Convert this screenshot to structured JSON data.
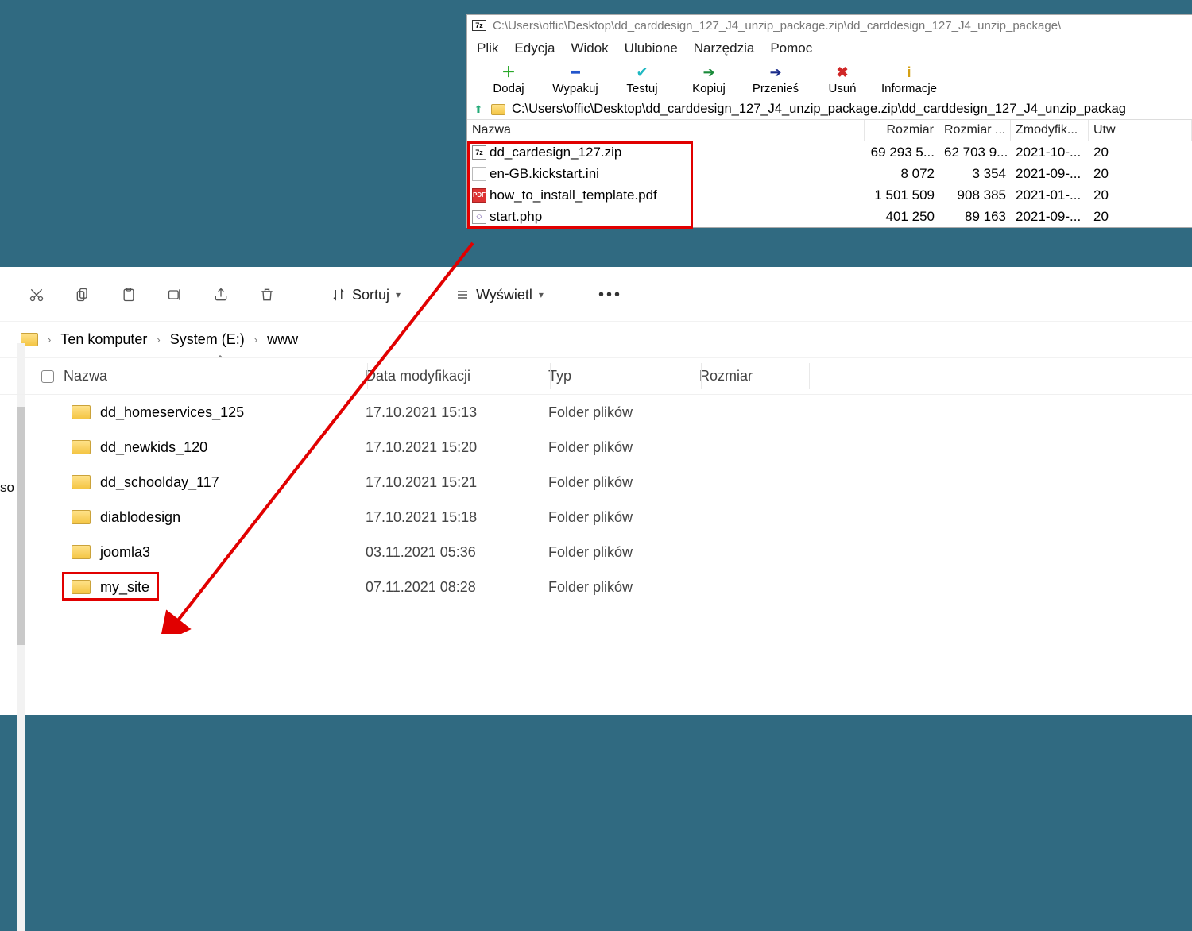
{
  "sevenzip": {
    "title": "C:\\Users\\offic\\Desktop\\dd_carddesign_127_J4_unzip_package.zip\\dd_carddesign_127_J4_unzip_package\\",
    "menu": [
      "Plik",
      "Edycja",
      "Widok",
      "Ulubione",
      "Narzędzia",
      "Pomoc"
    ],
    "toolbar": [
      {
        "label": "Dodaj",
        "name": "add-button",
        "glyph": "＋",
        "cls": "sym-plus"
      },
      {
        "label": "Wypakuj",
        "name": "extract-button",
        "glyph": "━",
        "cls": "sym-minus"
      },
      {
        "label": "Testuj",
        "name": "test-button",
        "glyph": "✔",
        "cls": "sym-check"
      },
      {
        "label": "Kopiuj",
        "name": "copy-button",
        "glyph": "➔",
        "cls": "sym-right"
      },
      {
        "label": "Przenieś",
        "name": "move-button",
        "glyph": "➔",
        "cls": "sym-right2"
      },
      {
        "label": "Usuń",
        "name": "delete-button",
        "glyph": "✖",
        "cls": "sym-x"
      },
      {
        "label": "Informacje",
        "name": "info-button",
        "glyph": "i",
        "cls": "sym-info"
      }
    ],
    "address": "C:\\Users\\offic\\Desktop\\dd_carddesign_127_J4_unzip_package.zip\\dd_carddesign_127_J4_unzip_packag",
    "columns": {
      "name": "Nazwa",
      "size": "Rozmiar",
      "packed": "Rozmiar ...",
      "mod": "Zmodyfik...",
      "crt": "Utw"
    },
    "rows": [
      {
        "icon": "7z",
        "name": "dd_cardesign_127.zip",
        "size": "69 293 5...",
        "packed": "62 703 9...",
        "mod": "2021-10-...",
        "crt": "20"
      },
      {
        "icon": "ini",
        "name": "en-GB.kickstart.ini",
        "size": "8 072",
        "packed": "3 354",
        "mod": "2021-09-...",
        "crt": "20"
      },
      {
        "icon": "pdf",
        "name": "how_to_install_template.pdf",
        "size": "1 501 509",
        "packed": "908 385",
        "mod": "2021-01-...",
        "crt": "20"
      },
      {
        "icon": "php",
        "name": "start.php",
        "size": "401 250",
        "packed": "89 163",
        "mod": "2021-09-...",
        "crt": "20"
      }
    ]
  },
  "explorer": {
    "side_fragment": "so",
    "sort_label": "Sortuj",
    "view_label": "Wyświetl",
    "breadcrumb": [
      "Ten komputer",
      "System (E:)",
      "www"
    ],
    "columns": {
      "name": "Nazwa",
      "date": "Data modyfikacji",
      "type": "Typ",
      "size": "Rozmiar"
    },
    "rows": [
      {
        "name": "dd_homeservices_125",
        "date": "17.10.2021 15:13",
        "type": "Folder plików"
      },
      {
        "name": "dd_newkids_120",
        "date": "17.10.2021 15:20",
        "type": "Folder plików"
      },
      {
        "name": "dd_schoolday_117",
        "date": "17.10.2021 15:21",
        "type": "Folder plików"
      },
      {
        "name": "diablodesign",
        "date": "17.10.2021 15:18",
        "type": "Folder plików"
      },
      {
        "name": "joomla3",
        "date": "03.11.2021 05:36",
        "type": "Folder plików"
      },
      {
        "name": "my_site",
        "date": "07.11.2021 08:28",
        "type": "Folder plików"
      }
    ]
  }
}
